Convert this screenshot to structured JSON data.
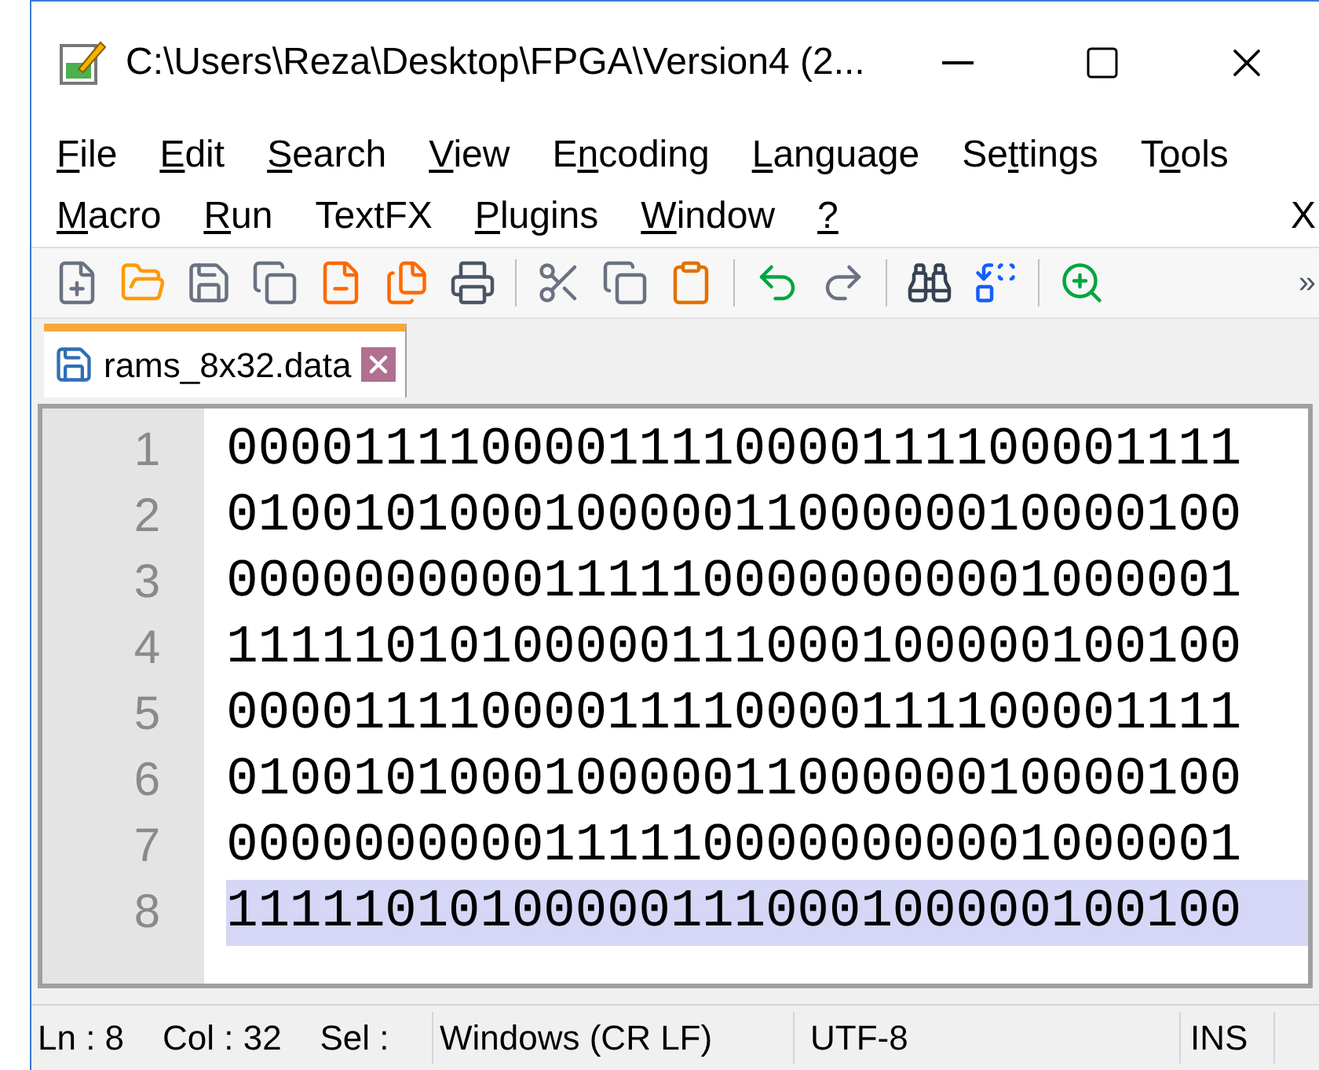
{
  "window": {
    "title": "C:\\Users\\Reza\\Desktop\\FPGA\\Version4 (2..."
  },
  "menu_rows": [
    [
      {
        "key": "F",
        "rest": "ile"
      },
      {
        "key": "E",
        "rest": "dit"
      },
      {
        "key": "S",
        "rest": "earch"
      },
      {
        "key": "V",
        "rest": "iew"
      },
      {
        "lead": "E",
        "key": "n",
        "rest": "coding"
      },
      {
        "key": "L",
        "rest": "anguage"
      },
      {
        "lead": "Se",
        "key": "t",
        "rest": "tings"
      },
      {
        "lead": "T",
        "key": "o",
        "rest": "ols"
      }
    ],
    [
      {
        "key": "M",
        "rest": "acro"
      },
      {
        "key": "R",
        "rest": "un"
      },
      {
        "lead": "TextFX"
      },
      {
        "key": "P",
        "rest": "lugins"
      },
      {
        "key": "W",
        "rest": "indow"
      },
      {
        "key": "?"
      }
    ]
  ],
  "menu_close": "X",
  "toolbar_more": "»",
  "tabs": [
    {
      "label": "rams_8x32.data",
      "selected": true
    }
  ],
  "editor": {
    "lines": [
      {
        "number": "1",
        "text": "00001111000011110000111100001111",
        "current": false
      },
      {
        "number": "2",
        "text": "01001010001000001100000010000100",
        "current": false
      },
      {
        "number": "3",
        "text": "00000000001111100000000001000001",
        "current": false
      },
      {
        "number": "4",
        "text": "11111010100000111000100000100100",
        "current": false
      },
      {
        "number": "5",
        "text": "00001111000011110000111100001111",
        "current": false
      },
      {
        "number": "6",
        "text": "01001010001000001100000010000100",
        "current": false
      },
      {
        "number": "7",
        "text": "00000000001111100000000001000001",
        "current": false
      },
      {
        "number": "8",
        "text": "11111010100000111000100000100100",
        "current": true
      }
    ]
  },
  "status_bar": {
    "position": "Ln : 8    Col : 32    Sel : ",
    "eol": "Windows (CR LF)",
    "encoding": "UTF-8",
    "mode": "INS"
  }
}
